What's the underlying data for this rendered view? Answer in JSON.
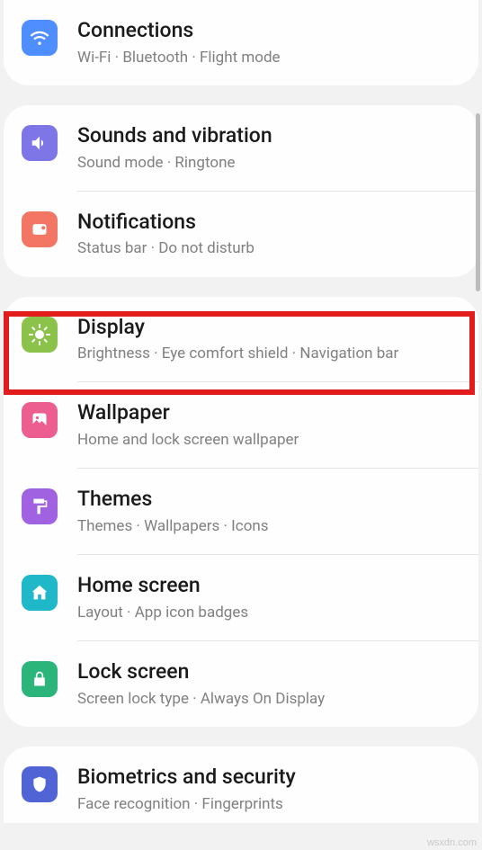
{
  "settings": {
    "connections": {
      "title": "Connections",
      "subtitle": "Wi-Fi · Bluetooth · Flight mode"
    },
    "sounds": {
      "title": "Sounds and vibration",
      "subtitle": "Sound mode · Ringtone"
    },
    "notifications": {
      "title": "Notifications",
      "subtitle": "Status bar · Do not disturb"
    },
    "display": {
      "title": "Display",
      "subtitle": "Brightness · Eye comfort shield · Navigation bar"
    },
    "wallpaper": {
      "title": "Wallpaper",
      "subtitle": "Home and lock screen wallpaper"
    },
    "themes": {
      "title": "Themes",
      "subtitle": "Themes · Wallpapers · Icons"
    },
    "homescreen": {
      "title": "Home screen",
      "subtitle": "Layout · App icon badges"
    },
    "lockscreen": {
      "title": "Lock screen",
      "subtitle": "Screen lock type · Always On Display"
    },
    "biometrics": {
      "title": "Biometrics and security",
      "subtitle": "Face recognition · Fingerprints"
    }
  },
  "colors": {
    "connections": "#4f8eff",
    "sounds": "#7e76e6",
    "notifications": "#f27663",
    "display": "#8bc34a",
    "wallpaper": "#ec5e8f",
    "themes": "#a062e0",
    "homescreen": "#1eb8c9",
    "lockscreen": "#2bb57a",
    "biometrics": "#5164d6"
  },
  "watermark": "wsxdn.com"
}
